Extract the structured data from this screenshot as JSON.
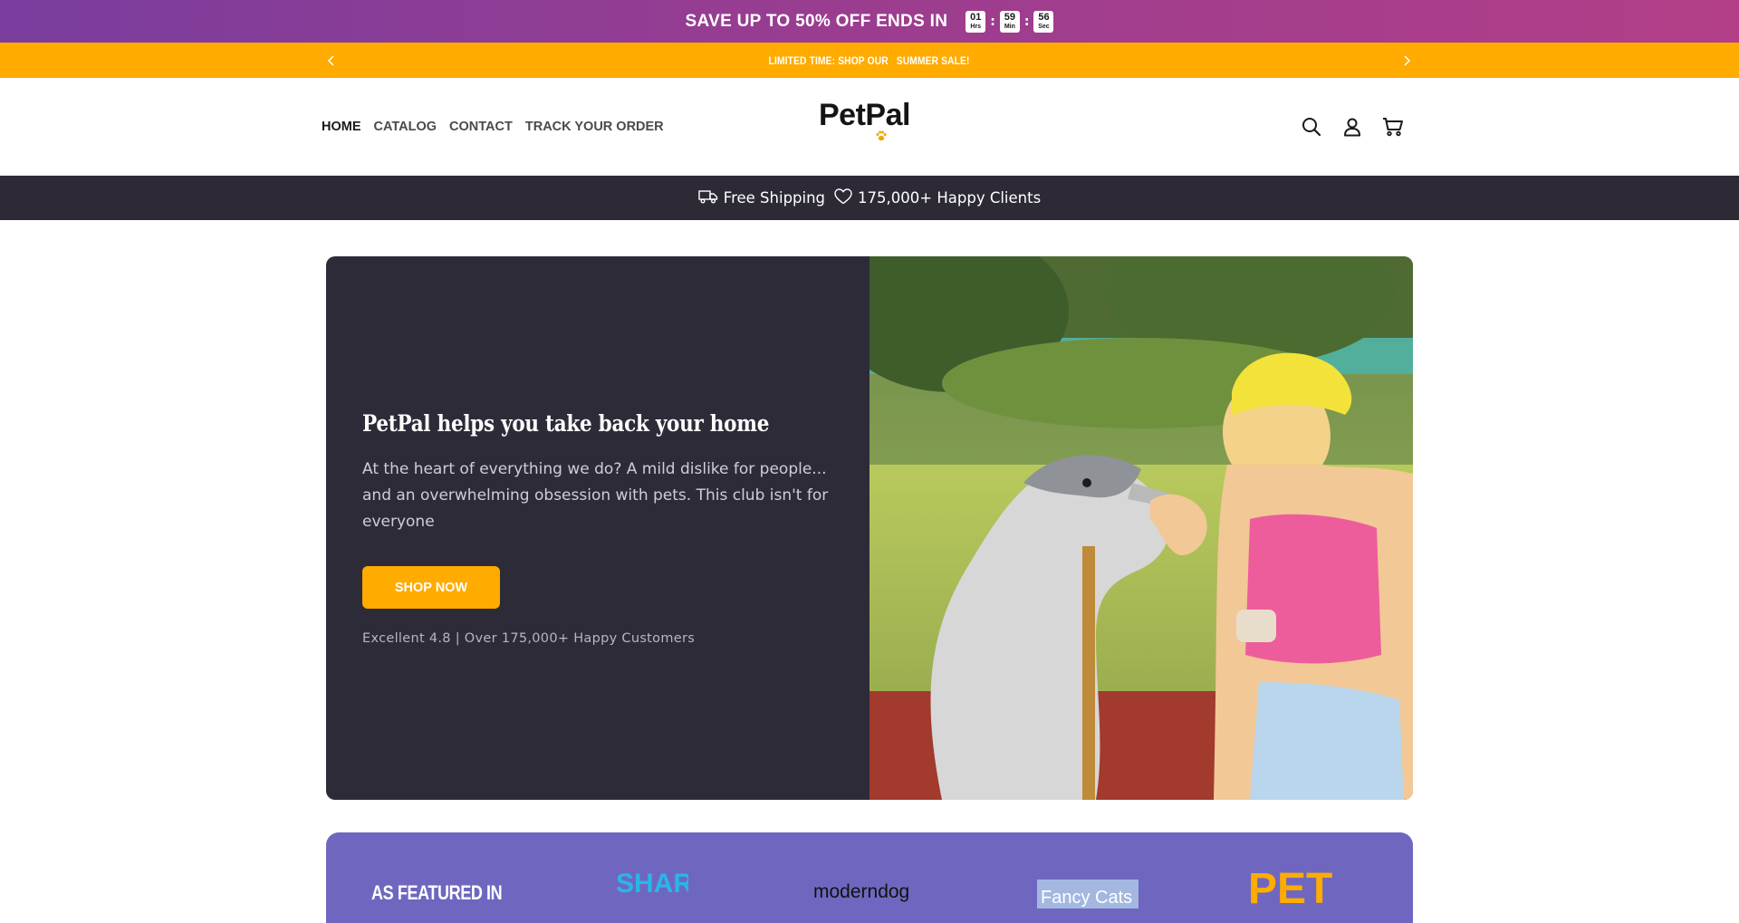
{
  "promo": {
    "text": "SAVE UP TO 50% OFF ENDS IN",
    "timer": [
      {
        "value": "01",
        "unit": "Hrs"
      },
      {
        "value": "59",
        "unit": "Min"
      },
      {
        "value": "56",
        "unit": "Sec"
      }
    ],
    "separator": ":",
    "colors": {
      "start": "#7a3d9e",
      "end": "#b23f88"
    }
  },
  "announcement": {
    "text": "LIMITED TIME: SHOP OUR   SUMMER SALE!",
    "prev_icon": "chevron-left-icon",
    "next_icon": "chevron-right-icon",
    "color": "#ffab00"
  },
  "header": {
    "nav": [
      "HOME",
      "CATALOG",
      "CONTACT",
      "TRACK YOUR ORDER"
    ],
    "active_nav": "HOME",
    "logo": "PetPal",
    "icons": [
      "search-icon",
      "account-icon",
      "cart-icon"
    ]
  },
  "trust": {
    "shipping": "Free Shipping",
    "clients": "175,000+ Happy Clients",
    "background": "#2d2a36"
  },
  "hero": {
    "title": "PetPal helps you take back your home",
    "description": "At the heart of everything we do? A mild dislike for people... and an overwhelming obsession with pets. This club isn't for everyone",
    "button": "SHOP NOW",
    "rating": "Excellent 4.8 | Over 175,000+ Happy Customers",
    "image_alt": "Woman in yellow bucket hat with husky dog in park"
  },
  "featured": {
    "title": "AS FEATURED IN",
    "logos": [
      "SHARK",
      "moderndog",
      "Fancy Cats",
      "PET"
    ],
    "background": "#6f67bf"
  }
}
